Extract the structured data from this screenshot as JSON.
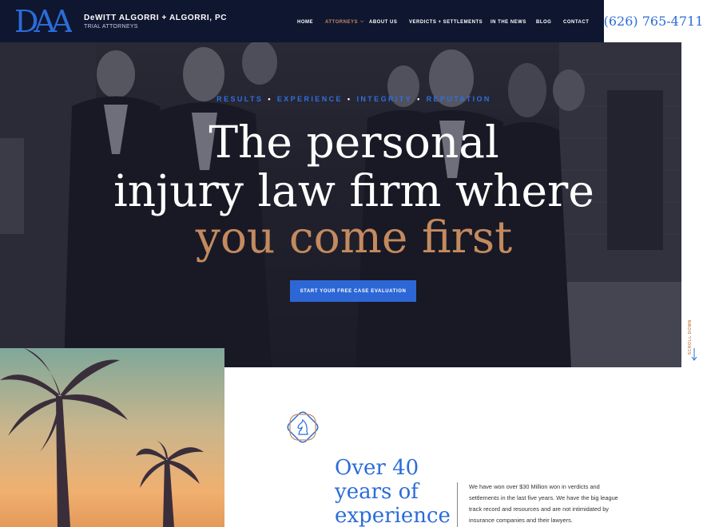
{
  "header": {
    "logo_text": "DAA",
    "firm_name": "DeWITT ALGORRI + ALGORRI, PC",
    "firm_subtitle": "TRIAL ATTORNEYS",
    "phone": "(626) 765-4711",
    "nav": [
      {
        "label": "HOME",
        "active": false
      },
      {
        "label": "ATTORNEYS",
        "active": true,
        "dropdown": true
      },
      {
        "label": "ABOUT US",
        "active": false
      },
      {
        "label": "VERDICTS + SETTLEMENTS",
        "active": false
      },
      {
        "label": "IN THE NEWS",
        "active": false
      },
      {
        "label": "BLOG",
        "active": false
      },
      {
        "label": "CONTACT",
        "active": false
      }
    ]
  },
  "hero": {
    "tagline": [
      "RESULTS",
      "EXPERIENCE",
      "INTEGRITY",
      "REPUTATION"
    ],
    "headline_line1": "The personal",
    "headline_line2": "injury law firm where",
    "headline_line3": "you come first",
    "cta_label": "START YOUR FREE CASE EVALUATION",
    "scroll_label": "SCROLL DOWN"
  },
  "about": {
    "title_lines": [
      "Over 40",
      "years of",
      "experience"
    ],
    "paragraph_lines": [
      "We have won over $30 Million won in verdicts and",
      "settlements in the last five years. We have the big league",
      "track record and resources and are not intimidated by",
      "insurance companies and their lawyers."
    ]
  },
  "colors": {
    "navy": "#0f1630",
    "accent_blue": "#2b6cd8",
    "accent_copper": "#c48a5e"
  },
  "icons": {
    "emblem": "knight-chess-icon",
    "scroll": "arrow-down-icon"
  }
}
